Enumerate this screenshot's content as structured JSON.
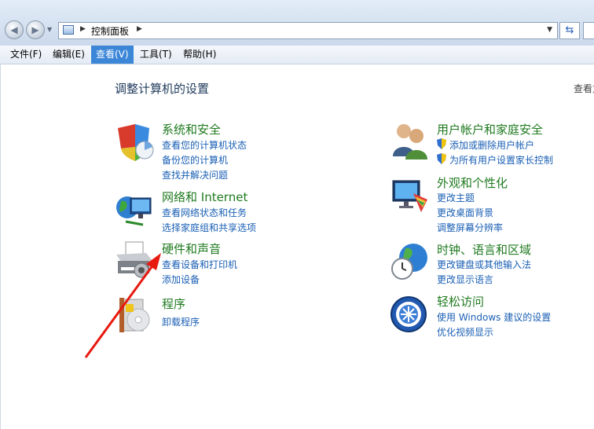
{
  "address": {
    "path": "控制面板"
  },
  "menu": [
    {
      "label": "文件(F)"
    },
    {
      "label": "编辑(E)"
    },
    {
      "label": "查看(V)"
    },
    {
      "label": "工具(T)"
    },
    {
      "label": "帮助(H)"
    }
  ],
  "page": {
    "title": "调整计算机的设置",
    "view_by": "查看方"
  },
  "categories": [
    {
      "title": "系统和安全",
      "links": [
        "查看您的计算机状态",
        "备份您的计算机",
        "查找并解决问题"
      ],
      "icon": "system-security-icon"
    },
    {
      "title": "网络和 Internet",
      "links": [
        "查看网络状态和任务",
        "选择家庭组和共享选项"
      ],
      "icon": "network-icon"
    },
    {
      "title": "硬件和声音",
      "links": [
        "查看设备和打印机",
        "添加设备"
      ],
      "icon": "printer-icon"
    },
    {
      "title": "程序",
      "links": [
        "卸载程序"
      ],
      "icon": "programs-icon"
    },
    {
      "title": "用户帐户和家庭安全",
      "links": [
        "添加或删除用户帐户",
        "为所有用户设置家长控制"
      ],
      "icon": "users-icon"
    },
    {
      "title": "外观和个性化",
      "links": [
        "更改主题",
        "更改桌面背景",
        "调整屏幕分辨率"
      ],
      "icon": "appearance-icon"
    },
    {
      "title": "时钟、语言和区域",
      "links": [
        "更改键盘或其他输入法",
        "更改显示语言"
      ],
      "icon": "clock-globe-icon"
    },
    {
      "title": "轻松访问",
      "links": [
        "使用 Windows 建议的设置",
        "优化视频显示"
      ],
      "icon": "ease-of-access-icon"
    }
  ],
  "colors": {
    "category_title": "#1f7a1f",
    "link": "#1a5fb4",
    "annotation_arrow": "#e8190f",
    "menu_active": "#3c86d8"
  }
}
